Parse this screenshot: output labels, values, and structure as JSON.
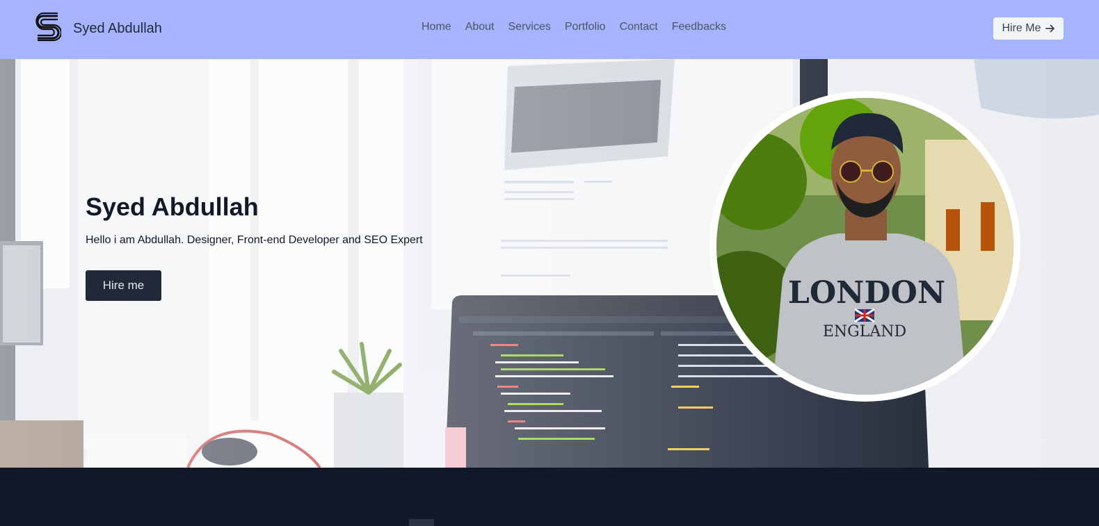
{
  "brand": {
    "name": "Syed Abdullah"
  },
  "nav": {
    "items": [
      {
        "label": "Home"
      },
      {
        "label": "About"
      },
      {
        "label": "Services"
      },
      {
        "label": "Portfolio"
      },
      {
        "label": "Contact"
      },
      {
        "label": "Feedbacks"
      }
    ],
    "cta_label": "Hire Me"
  },
  "hero": {
    "title": "Syed Abdullah",
    "subtitle": "Hello i am Abdullah. Designer, Front-end Developer and SEO Expert",
    "button_label": "Hire me",
    "photo": {
      "shirt_line1": "LONDON",
      "shirt_line2": "ENGLAND"
    }
  },
  "colors": {
    "navbar_bg": "#a5b4fc",
    "dark_bg": "#111827",
    "button_bg": "#1f2937"
  },
  "icons": {
    "logo": "s-logo-icon",
    "cta_arrow": "arrow-right-icon"
  }
}
